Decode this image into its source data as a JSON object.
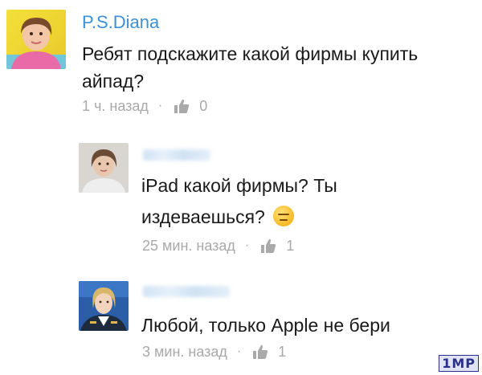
{
  "comments": [
    {
      "author": "P.S.Diana",
      "text_line1": "Ребят подскажите какой фирмы купить",
      "text_line2": "айпад?",
      "time": "1 ч. назад",
      "separator": "·",
      "likes": "0"
    },
    {
      "author": "",
      "text_line1": "iPad какой фирмы? Ты",
      "text_line2": "издеваешься?",
      "time": "25 мин. назад",
      "separator": "·",
      "likes": "1",
      "emoji": "expressionless-face-icon"
    },
    {
      "author": "",
      "text_line1": "Любой, только Apple не бери",
      "time": "3 мин. назад",
      "separator": "·",
      "likes": "1"
    }
  ],
  "watermark": "1MP",
  "colors": {
    "author": "#3d8fd6",
    "meta": "#a9a9a9",
    "text": "#1a1a1a"
  }
}
